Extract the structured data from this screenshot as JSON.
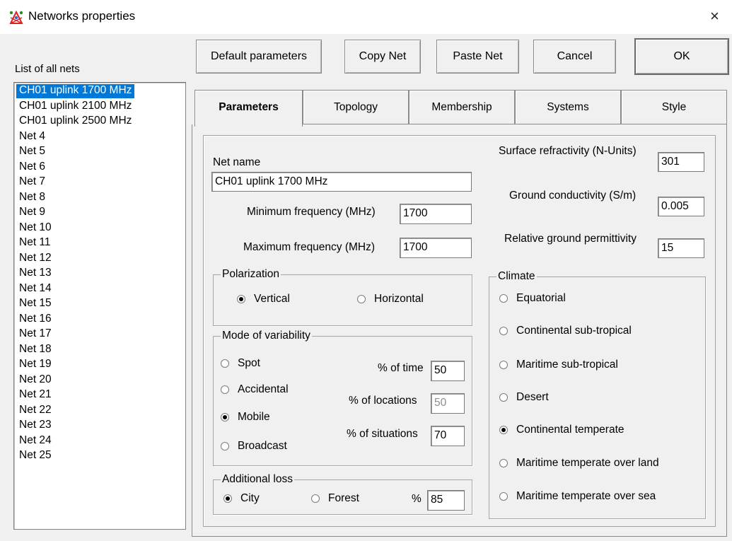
{
  "window": {
    "title": "Networks properties",
    "close": "×"
  },
  "list": {
    "label": "List of all nets",
    "items": [
      "CH01 uplink 1700 MHz",
      "CH01 uplink 2100 MHz",
      "CH01 uplink 2500 MHz",
      "Net  4",
      "Net  5",
      "Net  6",
      "Net  7",
      "Net  8",
      "Net  9",
      "Net 10",
      "Net 11",
      "Net 12",
      "Net 13",
      "Net 14",
      "Net 15",
      "Net 16",
      "Net 17",
      "Net 18",
      "Net 19",
      "Net 20",
      "Net 21",
      "Net 22",
      "Net 23",
      "Net 24",
      "Net 25"
    ],
    "selected_index": 0
  },
  "buttons": {
    "default": "Default parameters",
    "copy": "Copy Net",
    "paste": "Paste Net",
    "cancel": "Cancel",
    "ok": "OK"
  },
  "tabs": [
    "Parameters",
    "Topology",
    "Membership",
    "Systems",
    "Style"
  ],
  "active_tab": 0,
  "params": {
    "net_name_label": "Net name",
    "net_name": "CH01 uplink 1700 MHz",
    "min_freq_label": "Minimum frequency (MHz)",
    "min_freq": "1700",
    "max_freq_label": "Maximum frequency (MHz)",
    "max_freq": "1700",
    "surface_label": "Surface refractivity (N-Units)",
    "surface": "301",
    "ground_cond_label": "Ground conductivity (S/m)",
    "ground_cond": "0.005",
    "rel_perm_label": "Relative ground permittivity",
    "rel_perm": "15"
  },
  "polarization": {
    "legend": "Polarization",
    "options": [
      "Vertical",
      "Horizontal"
    ],
    "selected": "Vertical"
  },
  "variability": {
    "legend": "Mode of variability",
    "options": [
      "Spot",
      "Accidental",
      "Mobile",
      "Broadcast"
    ],
    "selected": "Mobile",
    "time_label": "% of time",
    "time": "50",
    "locations_label": "% of locations",
    "locations": "50",
    "situations_label": "% of situations",
    "situations": "70"
  },
  "loss": {
    "legend": "Additional loss",
    "options": [
      "City",
      "Forest"
    ],
    "selected": "City",
    "percent_label": "%",
    "percent": "85"
  },
  "climate": {
    "legend": "Climate",
    "options": [
      "Equatorial",
      "Continental sub-tropical",
      "Maritime sub-tropical",
      "Desert",
      "Continental temperate",
      "Maritime temperate over land",
      "Maritime temperate over sea"
    ],
    "selected": "Continental temperate"
  },
  "colors": {
    "selection": "#0078d7",
    "window_bg": "#f0f0f0"
  }
}
